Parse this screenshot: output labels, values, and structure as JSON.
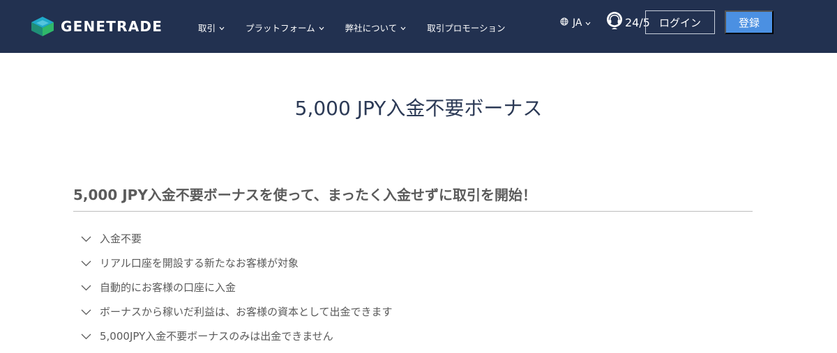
{
  "brand": {
    "name": "GENETRADE"
  },
  "nav": {
    "items": [
      {
        "label": "取引",
        "has_dropdown": true
      },
      {
        "label": "プラットフォーム",
        "has_dropdown": true
      },
      {
        "label": "弊社について",
        "has_dropdown": true
      },
      {
        "label": "取引プロモーション",
        "has_dropdown": false
      }
    ]
  },
  "header": {
    "language": "JA",
    "support_hours": "24/5",
    "login_label": "ログイン",
    "register_label": "登録"
  },
  "colors": {
    "navbar_bg": "#223150",
    "register_bg": "#4b90e2",
    "title_text": "#2c3a56"
  },
  "icons": [
    "logo-icon",
    "chevron-down-icon",
    "globe-icon",
    "headset-icon",
    "check-chevron-icon"
  ],
  "main": {
    "title": "5,000 JPY入金不要ボーナス",
    "subtitle": "5,000 JPY入金不要ボーナスを使って、まったく入金せずに取引を開始！",
    "benefits": [
      "入金不要",
      "リアル口座を開設する新たなお客様が対象",
      "自動的にお客様の口座に入金",
      "ボーナスから稼いだ利益は、お客様の資本として出金できます",
      "5,000JPY入金不要ボーナスのみは出金できません"
    ]
  }
}
